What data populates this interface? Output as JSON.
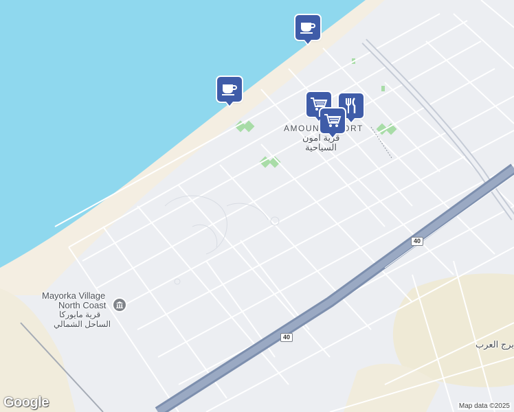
{
  "labels": {
    "resort_en": "AMOUN RESORT",
    "resort_ar_line1": "قرية امون",
    "resort_ar_line2": "السياحية",
    "mayorka_en_line1": "Mayorka Village",
    "mayorka_en_line2": "North Coast",
    "mayorka_ar_line1": "قرية مايوركا",
    "mayorka_ar_line2": "الساحل الشمالي",
    "burj_al_arab": "برج العرب"
  },
  "road_shields": {
    "upper": "40",
    "lower": "40"
  },
  "markers": [
    {
      "type": "cafe",
      "icon": "coffee-cup-icon"
    },
    {
      "type": "cafe",
      "icon": "coffee-cup-icon"
    },
    {
      "type": "shopping",
      "icon": "shopping-cart-icon"
    },
    {
      "type": "restaurant",
      "icon": "fork-knife-icon"
    },
    {
      "type": "shopping",
      "icon": "shopping-cart-icon"
    }
  ],
  "branding": {
    "logo": "Google",
    "attribution": "Map data ©2025"
  },
  "colors": {
    "sea": "#8fd8ee",
    "land": "#eceef2",
    "beach": "#f4eee2",
    "desert": "#f1ecdc",
    "park": "#a8dca7",
    "highway": "#8b9cb8",
    "marker": "#3f5ca8"
  }
}
